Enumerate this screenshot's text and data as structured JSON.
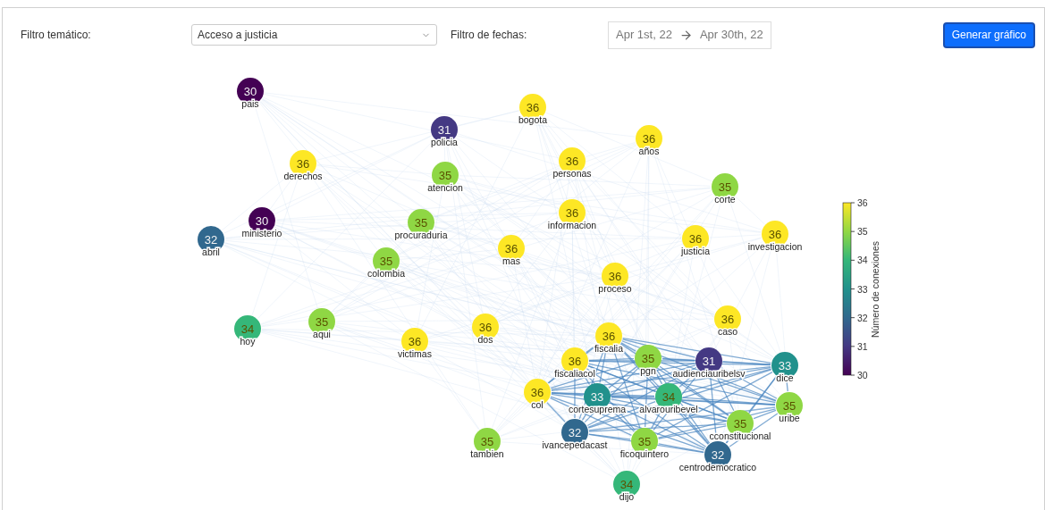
{
  "filters": {
    "topic": {
      "label": "Filtro temático:",
      "value": "Acceso a justicia"
    },
    "dates": {
      "label": "Filtro de fechas:",
      "start": "Apr 1st, 22",
      "end": "Apr 30th, 22"
    },
    "generate_button": "Generar gráfico"
  },
  "graph": {
    "nodes": [
      {
        "label": "pais",
        "count": "30",
        "color": "#440154"
      },
      {
        "label": "policia",
        "count": "31",
        "color": "#443983"
      },
      {
        "label": "bogota",
        "count": "36",
        "color": "#fde725"
      },
      {
        "label": "años",
        "count": "36",
        "color": "#fde725"
      },
      {
        "label": "derechos",
        "count": "36",
        "color": "#fde725"
      },
      {
        "label": "atencion",
        "count": "35",
        "color": "#8fd744"
      },
      {
        "label": "personas",
        "count": "36",
        "color": "#fde725"
      },
      {
        "label": "corte",
        "count": "35",
        "color": "#8fd744"
      },
      {
        "label": "ministerio",
        "count": "30",
        "color": "#440154"
      },
      {
        "label": "procuraduria",
        "count": "35",
        "color": "#8fd744"
      },
      {
        "label": "informacion",
        "count": "36",
        "color": "#fde725"
      },
      {
        "label": "abril",
        "count": "32",
        "color": "#31688e"
      },
      {
        "label": "mas",
        "count": "36",
        "color": "#fde725"
      },
      {
        "label": "justicia",
        "count": "36",
        "color": "#fde725"
      },
      {
        "label": "investigacion",
        "count": "36",
        "color": "#fde725"
      },
      {
        "label": "colombia",
        "count": "35",
        "color": "#8fd744"
      },
      {
        "label": "proceso",
        "count": "36",
        "color": "#fde725"
      },
      {
        "label": "hoy",
        "count": "34",
        "color": "#35b779"
      },
      {
        "label": "aqui",
        "count": "35",
        "color": "#8fd744"
      },
      {
        "label": "victimas",
        "count": "36",
        "color": "#fde725"
      },
      {
        "label": "dos",
        "count": "36",
        "color": "#fde725"
      },
      {
        "label": "caso",
        "count": "36",
        "color": "#fde725"
      },
      {
        "label": "fiscalia",
        "count": "36",
        "color": "#fde725"
      },
      {
        "label": "fiscaliacol",
        "count": "36",
        "color": "#fde725"
      },
      {
        "label": "pgn",
        "count": "35",
        "color": "#8fd744"
      },
      {
        "label": "audienciauribelsv",
        "count": "31",
        "color": "#443983"
      },
      {
        "label": "dice",
        "count": "33",
        "color": "#21918c"
      },
      {
        "label": "col",
        "count": "36",
        "color": "#fde725"
      },
      {
        "label": "cortesuprema",
        "count": "33",
        "color": "#21918c"
      },
      {
        "label": "alvarouribevel",
        "count": "34",
        "color": "#35b779"
      },
      {
        "label": "cconstitucional",
        "count": "35",
        "color": "#8fd744"
      },
      {
        "label": "uribe",
        "count": "35",
        "color": "#8fd744"
      },
      {
        "label": "ivancepedacast",
        "count": "32",
        "color": "#31688e"
      },
      {
        "label": "ficoquintero",
        "count": "35",
        "color": "#8fd744"
      },
      {
        "label": "centrodemocratico",
        "count": "32",
        "color": "#31688e"
      },
      {
        "label": "tambien",
        "count": "35",
        "color": "#8fd744"
      },
      {
        "label": "dijo",
        "count": "34",
        "color": "#35b779"
      }
    ],
    "colorbar": {
      "title": "Número de conexiones",
      "ticks": [
        "36",
        "35",
        "34",
        "33",
        "32",
        "31",
        "30"
      ]
    }
  }
}
